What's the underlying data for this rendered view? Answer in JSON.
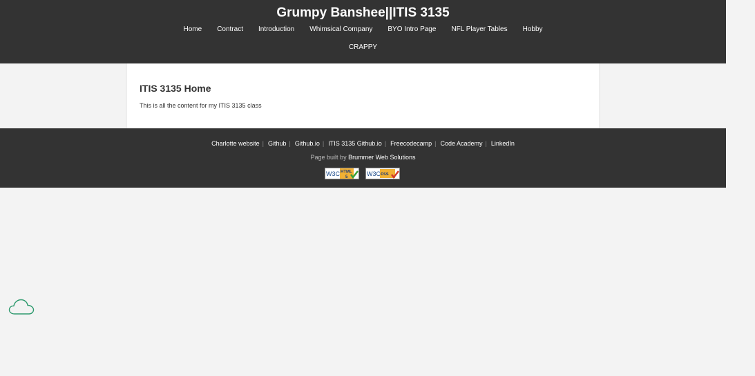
{
  "header": {
    "title": "Grumpy Banshee||ITIS 3135",
    "nav": [
      {
        "label": "Home"
      },
      {
        "label": "Contract"
      },
      {
        "label": "Introduction"
      },
      {
        "label": "Whimsical Company"
      },
      {
        "label": "BYO Intro Page"
      },
      {
        "label": "NFL Player Tables"
      },
      {
        "label": "Hobby"
      },
      {
        "label": "CRAPPY"
      }
    ]
  },
  "main": {
    "heading": "ITIS 3135 Home",
    "body": "This is all the content for my ITIS 3135 class"
  },
  "footer": {
    "links": [
      {
        "label": "Charlotte website"
      },
      {
        "label": "Github"
      },
      {
        "label": "Github.io"
      },
      {
        "label": "ITIS 3135 Github.io"
      },
      {
        "label": "Freecodecamp"
      },
      {
        "label": "Code Academy"
      },
      {
        "label": "LinkedIn"
      }
    ],
    "separator": "|",
    "credit_prefix": "Page built by",
    "credit_link": "Brummer Web Solutions",
    "badges": {
      "html": {
        "w3c": "W3C",
        "line1": "HTML",
        "line2": "5"
      },
      "css": {
        "w3c": "W3C",
        "line1": "css"
      }
    }
  },
  "colors": {
    "header_bg": "#333333",
    "page_bg": "#f3f3f3",
    "cloud": "#2e9a6e"
  },
  "icons": {
    "cloud": "cloud-icon",
    "html_badge": "w3c-html5-badge-icon",
    "css_badge": "w3c-css-badge-icon"
  }
}
